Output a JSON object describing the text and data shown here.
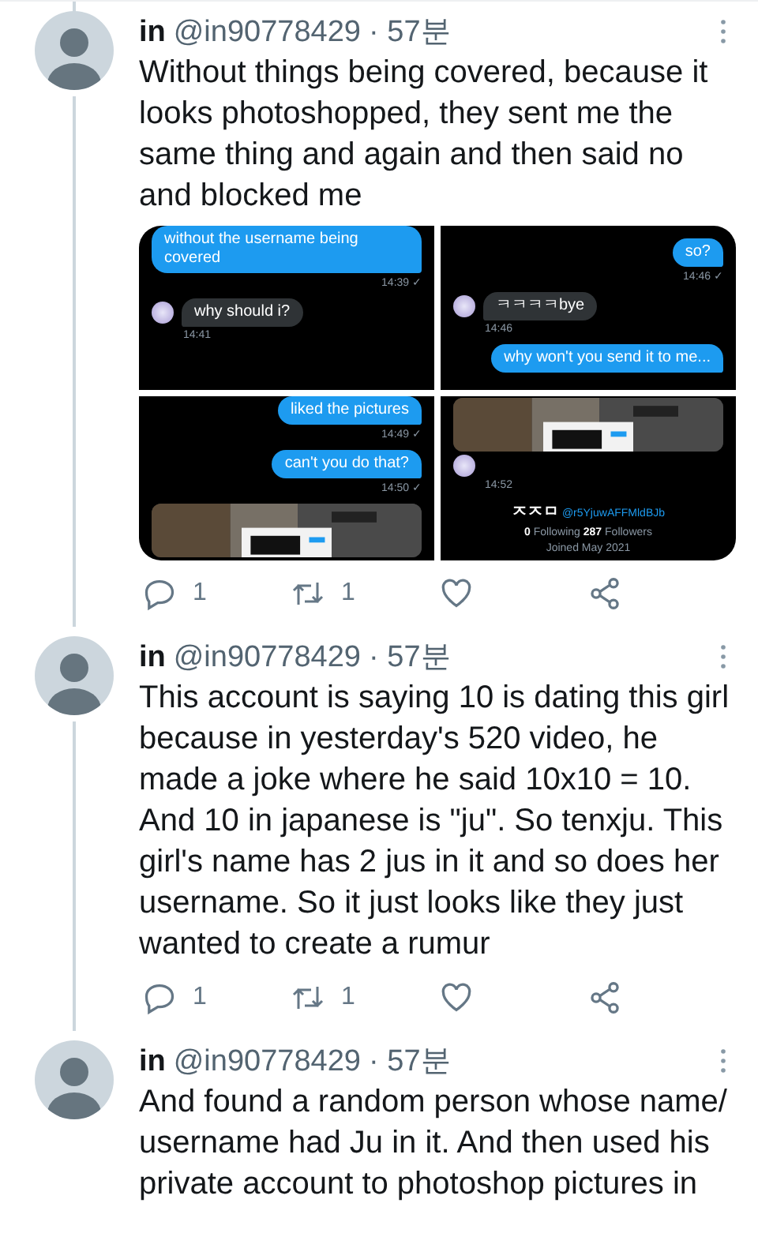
{
  "tweets": [
    {
      "name": "in",
      "handle": "@in90778429",
      "time": "· 57분",
      "text": "Without things being covered, because it looks photoshopped, they sent me the same thing and again and then said no and blocked me",
      "media": [
        {
          "items": [
            {
              "kind": "sent",
              "text": "without the username being covered",
              "time": "14:39 ✓"
            },
            {
              "kind": "received",
              "text": "why should i?",
              "time": "14:41"
            }
          ]
        },
        {
          "items": [
            {
              "kind": "sent",
              "text": "so?",
              "time": "14:46 ✓"
            },
            {
              "kind": "received",
              "text": "ㅋㅋㅋㅋbye",
              "time": "14:46"
            },
            {
              "kind": "sent",
              "text": "why won't you send it to me..."
            }
          ]
        },
        {
          "items": [
            {
              "kind": "sent",
              "text": "liked the pictures",
              "time": "14:49 ✓"
            },
            {
              "kind": "sent",
              "text": "can't you do that?",
              "time": "14:50 ✓"
            },
            {
              "kind": "picture"
            }
          ]
        },
        {
          "items": [
            {
              "kind": "picture"
            },
            {
              "kind": "received_picture",
              "time": "14:52"
            },
            {
              "kind": "profile",
              "name": "ㅈㅈㅁ",
              "handle": "@r5YjuwAFFMldBJb",
              "stats": "**0** Following **287** Followers",
              "joined": "Joined May 2021"
            }
          ]
        }
      ],
      "replies": "1",
      "retweets": "1"
    },
    {
      "name": "in",
      "handle": "@in90778429",
      "time": "· 57분",
      "text": "This account is saying 10 is dating this girl because in yesterday's 520 video, he made a joke where he said 10x10 = 10. And 10 in japanese is \"ju\". So tenxju. This girl's name has 2 jus in it and so does her username. So it just looks like they just wanted to create a rumur",
      "replies": "1",
      "retweets": "1"
    },
    {
      "name": "in",
      "handle": "@in90778429",
      "time": "· 57분",
      "text": "And found a random person whose name/ username had Ju in it. And then used his private account to photoshop pictures in"
    }
  ]
}
